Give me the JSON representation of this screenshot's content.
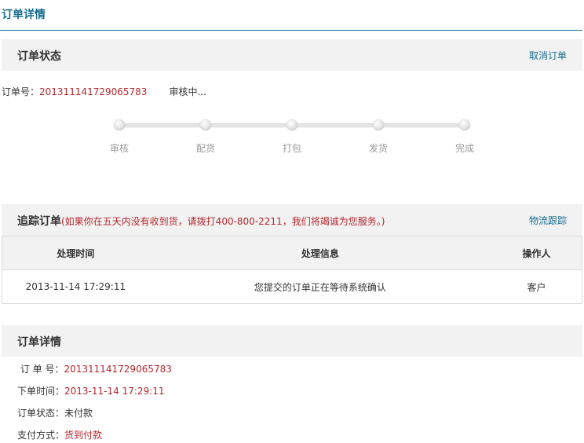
{
  "page": {
    "title": "订单详情"
  },
  "status_section": {
    "heading": "订单状态",
    "cancel_label": "取消订单",
    "order_no_label": "订单号：",
    "order_no": "201311141729065783",
    "status_text": "审核中..."
  },
  "progress": {
    "steps": [
      "审核",
      "配货",
      "打包",
      "发货",
      "完成"
    ]
  },
  "tracking": {
    "heading": "追踪订单",
    "note": "(如果你在五天内没有收到货，请拨打400-800-2211，我们将竭诚为您服务。)",
    "logistics_label": "物流跟踪",
    "columns": [
      "处理时间",
      "处理信息",
      "操作人"
    ],
    "rows": [
      [
        "2013-11-14 17:29:11",
        "您提交的订单正在等待系统确认",
        "客户"
      ]
    ]
  },
  "details": {
    "heading": "订单详情",
    "fields": [
      {
        "label": " 订 单 号：",
        "value": "201311141729065783"
      },
      {
        "label": "下单时间：",
        "value": "2013-11-14 17:29:11"
      },
      {
        "label": "订单状态：",
        "value": "未付款"
      },
      {
        "label": "支付方式：",
        "value": "货到付款"
      }
    ]
  },
  "colors": {
    "accent": "#1a6d8f",
    "highlight": "#b4272d",
    "header_bg": "#f2f2f2"
  }
}
